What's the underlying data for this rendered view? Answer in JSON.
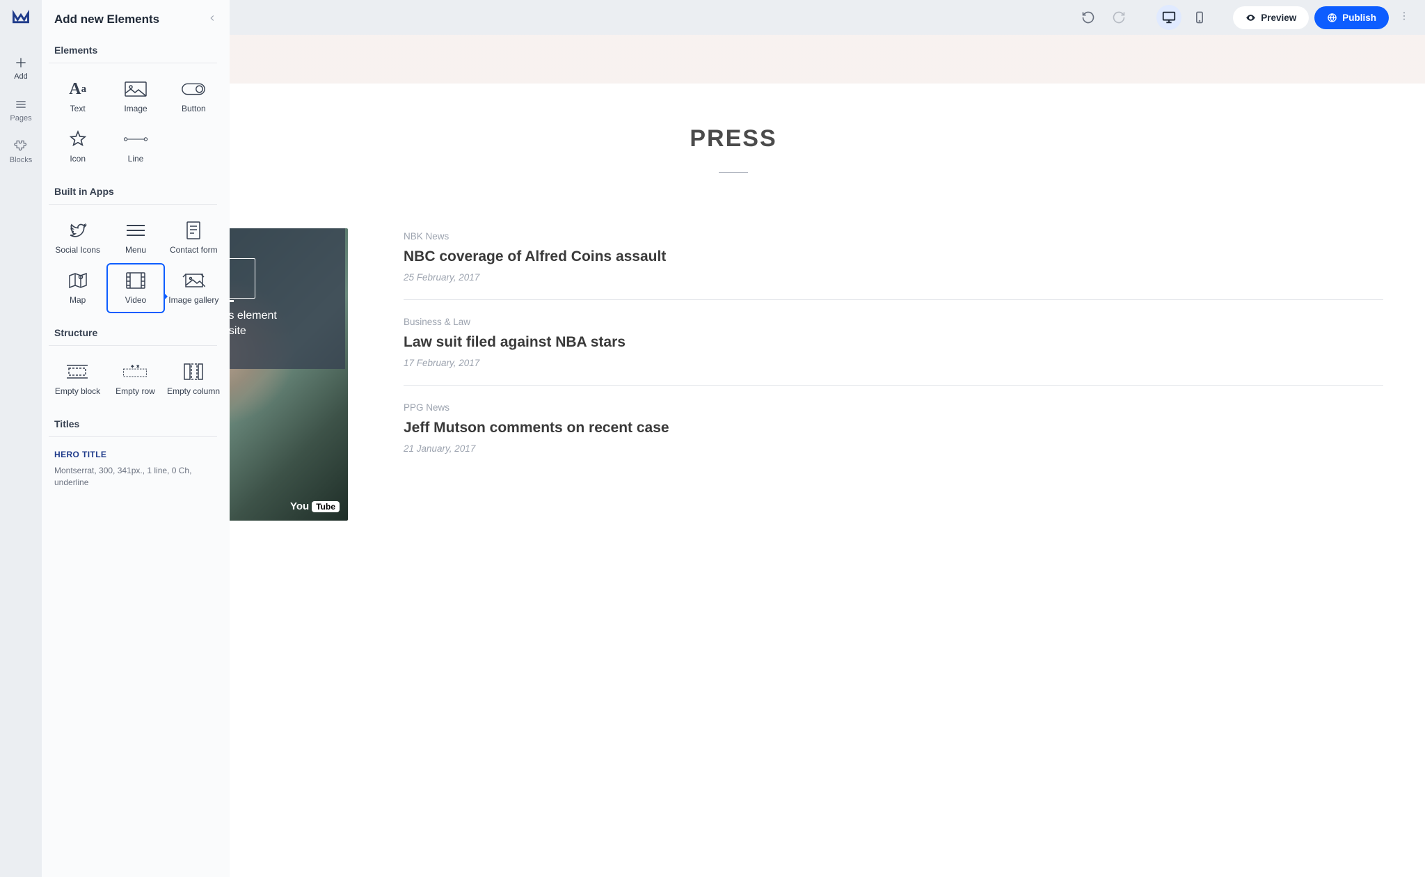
{
  "topbar": {
    "preview_label": "Preview",
    "publish_label": "Publish"
  },
  "leftbar": {
    "add": "Add",
    "pages": "Pages",
    "blocks": "Blocks"
  },
  "panel": {
    "title": "Add new Elements",
    "sections": {
      "elements": "Elements",
      "builtin": "Built in Apps",
      "structure": "Structure",
      "titles": "Titles"
    },
    "elements": {
      "text": "Text",
      "image": "Image",
      "button": "Button",
      "icon": "Icon",
      "line": "Line"
    },
    "builtin": {
      "social": "Social Icons",
      "menu": "Menu",
      "contact": "Contact form",
      "map": "Map",
      "video": "Video",
      "gallery": "Image gallery"
    },
    "structure": {
      "block": "Empty block",
      "row": "Empty row",
      "column": "Empty column"
    },
    "title_preset": {
      "name": "HERO TITLE",
      "meta": "Montserrat, 300, 341px., 1 line, 0 Ch, underline"
    }
  },
  "drag_hint": {
    "line1": "Drag and Drop this element",
    "line2": "to your website"
  },
  "press": {
    "heading": "PRESS",
    "video_brand": "You",
    "video_brand2": "Tube",
    "items": [
      {
        "category": "NBK News",
        "title": "NBC coverage of Alfred Coins assault",
        "date": "25 February, 2017"
      },
      {
        "category": "Business & Law",
        "title": "Law suit filed against NBA stars",
        "date": "17 February, 2017"
      },
      {
        "category": "PPG News",
        "title": "Jeff Mutson comments on recent case",
        "date": "21 January, 2017"
      }
    ]
  }
}
